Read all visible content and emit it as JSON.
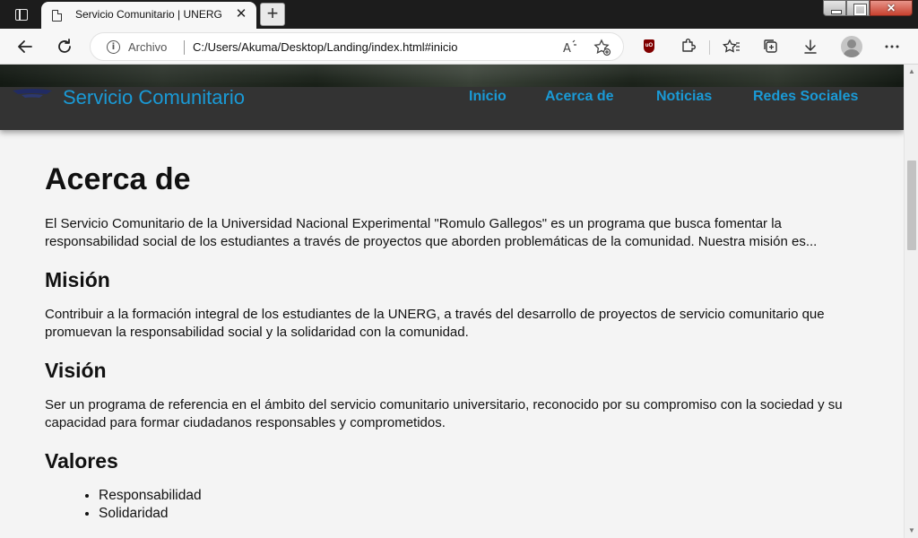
{
  "browser": {
    "tab_title": "Servicio Comunitario | UNERG",
    "tab_close": "✕",
    "new_tab": "+",
    "address_origin": "Archivo",
    "address_url": "C:/Users/Akuma/Desktop/Landing/index.html#inicio",
    "icons": {
      "back": "back-arrow-icon",
      "reload": "reload-icon",
      "read_aloud": "read-aloud-icon",
      "add_favorite": "add-favorite-icon",
      "ublock": "ublock-origin-icon",
      "extensions": "extensions-icon",
      "favorites": "favorites-icon",
      "collections": "collections-icon",
      "downloads": "downloads-icon",
      "profile": "profile-avatar",
      "menu": "more-menu-icon"
    }
  },
  "site": {
    "title": "Servicio Comunitario",
    "nav": [
      "Inicio",
      "Acerca de",
      "Noticias",
      "Redes Sociales"
    ],
    "colors": {
      "header_bg": "#333333",
      "accent": "#1a9ad6",
      "page_bg": "#f4f4f4"
    }
  },
  "content": {
    "heading": "Acerca de",
    "intro": "El Servicio Comunitario de la Universidad Nacional Experimental \"Romulo Gallegos\" es un programa que busca fomentar la responsabilidad social de los estudiantes a través de proyectos que aborden problemáticas de la comunidad. Nuestra misión es...",
    "mision_heading": "Misión",
    "mision_text": "Contribuir a la formación integral de los estudiantes de la UNERG, a través del desarrollo de proyectos de servicio comunitario que promuevan la responsabilidad social y la solidaridad con la comunidad.",
    "vision_heading": "Visión",
    "vision_text": "Ser un programa de referencia en el ámbito del servicio comunitario universitario, reconocido por su compromiso con la sociedad y su capacidad para formar ciudadanos responsables y comprometidos.",
    "valores_heading": "Valores",
    "valores": [
      "Responsabilidad",
      "Solidaridad"
    ]
  }
}
